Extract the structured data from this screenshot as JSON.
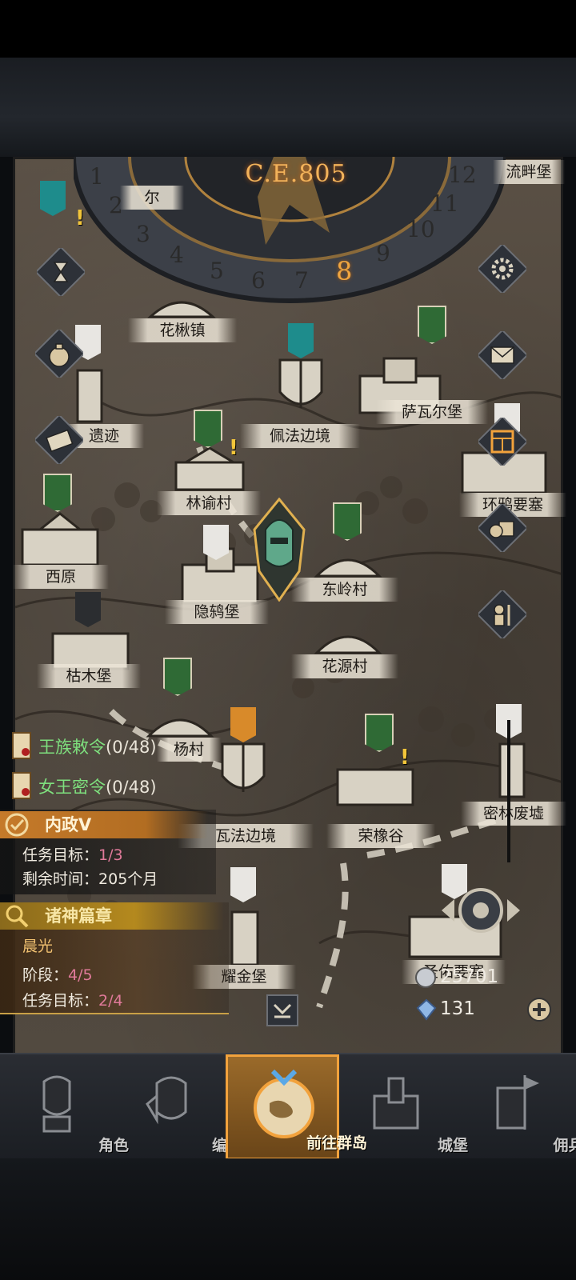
{
  "calendar": {
    "year_label": "C.E.805",
    "months": [
      "1",
      "2",
      "3",
      "4",
      "5",
      "6",
      "7",
      "8",
      "9",
      "10",
      "11",
      "12"
    ],
    "current_month": "8"
  },
  "locations": [
    {
      "name": "流畔堡"
    },
    {
      "name": "尔"
    },
    {
      "name": "花楸镇"
    },
    {
      "name": "遗迹"
    },
    {
      "name": "佩法边境"
    },
    {
      "name": "萨瓦尔堡"
    },
    {
      "name": "林谕村"
    },
    {
      "name": "环鸦要塞"
    },
    {
      "name": "西原"
    },
    {
      "name": "隐鸫堡"
    },
    {
      "name": "东岭村"
    },
    {
      "name": "枯木堡"
    },
    {
      "name": "花源村"
    },
    {
      "name": "杨村"
    },
    {
      "name": "瓦法边境"
    },
    {
      "name": "荣橡谷"
    },
    {
      "name": "密林废墟"
    },
    {
      "name": "耀金堡"
    },
    {
      "name": "圣佑要塞"
    }
  ],
  "quests": {
    "royal_decree": {
      "label": "王族敕令",
      "count": "(0/48)"
    },
    "queen_secret": {
      "label": "女王密令",
      "count": "(0/48)"
    },
    "domestic": {
      "title": "内政V",
      "target_label": "任务目标：",
      "target_value": "1/3",
      "time_label": "剩余时间：",
      "time_value": "205个月"
    },
    "gods": {
      "title": "诸神篇章",
      "subtitle": "晨光",
      "stage_label": "阶段：",
      "stage_value": "4/5",
      "target_label": "任务目标：",
      "target_value": "2/4"
    }
  },
  "currency": {
    "silver": "25701",
    "crystal": "131"
  },
  "right_icons": [
    "settings-gear-icon",
    "mail-icon",
    "calendar-grid-icon",
    "supply-crates-icon",
    "army-marching-icon"
  ],
  "left_icons": [
    "hourglass-icon",
    "money-bag-icon",
    "scroll-map-icon"
  ],
  "nav": {
    "items": [
      {
        "label": "角色"
      },
      {
        "label": "编队"
      },
      {
        "label": "前往群岛"
      },
      {
        "label": "城堡"
      },
      {
        "label": "佣兵团"
      }
    ],
    "active_index": 2
  },
  "colors": {
    "accent_gold": "#f2a23c",
    "quest_green": "#7ee07e",
    "progress_pink": "#e07a9a"
  }
}
